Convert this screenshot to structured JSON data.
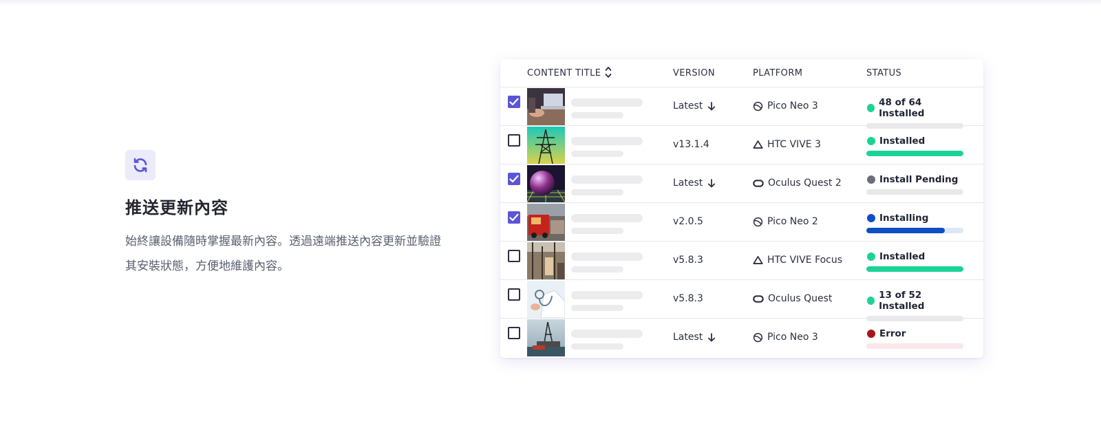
{
  "feature": {
    "title": "推送更新內容",
    "description": "始終讓設備隨時掌握最新內容。透過遠端推送內容更新並驗證其安裝狀態，方便地維護內容。",
    "icon": "refresh-icon",
    "icon_color": "#5b55d6",
    "icon_bg": "#ecebfb"
  },
  "table": {
    "columns": {
      "title": "CONTENT TITLE",
      "version": "VERSION",
      "platform": "PLATFORM",
      "status": "STATUS"
    },
    "rows": [
      {
        "checked": true,
        "thumb": "laptop-desk",
        "version": "Latest",
        "version_arrow": true,
        "platform": "Pico Neo 3",
        "platform_icon": "pico-icon",
        "status": "48 of 64 Installed",
        "status_color": "#1ad396",
        "progress": 0,
        "bar_track": "#e9e9ec",
        "bar_fill": "#1ad396"
      },
      {
        "checked": false,
        "thumb": "power-tower",
        "version": "v13.1.4",
        "version_arrow": false,
        "platform": "HTC VIVE 3",
        "platform_icon": "htc-icon",
        "status": "Installed",
        "status_color": "#1ad396",
        "progress": 1,
        "bar_track": "#e9e9ec",
        "bar_fill": "#1ad396"
      },
      {
        "checked": true,
        "thumb": "sphere-grid",
        "version": "Latest",
        "version_arrow": true,
        "platform": "Oculus Quest 2",
        "platform_icon": "oculus-icon",
        "status": "Install Pending",
        "status_color": "#6b6f7b",
        "progress": 0,
        "bar_track": "#e9e9ec",
        "bar_fill": "#6b6f7b"
      },
      {
        "checked": true,
        "thumb": "fire-truck",
        "version": "v2.0.5",
        "version_arrow": false,
        "platform": "Pico Neo 2",
        "platform_icon": "pico-icon",
        "status": "Installing",
        "status_color": "#0f4fc4",
        "progress": 0.81,
        "bar_track": "#dbe8fb",
        "bar_fill": "#0f4fc4"
      },
      {
        "checked": false,
        "thumb": "factory",
        "version": "v5.8.3",
        "version_arrow": false,
        "platform": "HTC VIVE Focus",
        "platform_icon": "htc-icon",
        "status": "Installed",
        "status_color": "#1ad396",
        "progress": 1,
        "bar_track": "#e9e9ec",
        "bar_fill": "#1ad396"
      },
      {
        "checked": false,
        "thumb": "doctor",
        "version": "v5.8.3",
        "version_arrow": false,
        "platform": "Oculus Quest",
        "platform_icon": "oculus-icon",
        "status": "13 of 52 Installed",
        "status_color": "#1ad396",
        "progress": 0,
        "bar_track": "#e9e9ec",
        "bar_fill": "#1ad396"
      },
      {
        "checked": false,
        "thumb": "oil-rig",
        "version": "Latest",
        "version_arrow": true,
        "platform": "Pico Neo 3",
        "platform_icon": "pico-icon",
        "status": "Error",
        "status_color": "#a8141a",
        "progress": 0,
        "bar_track": "#fbe6ea",
        "bar_fill": "#a8141a"
      }
    ]
  },
  "colors": {
    "accent": "#5b55d6",
    "success": "#1ad396",
    "info": "#0f4fc4",
    "error": "#a8141a",
    "pending": "#6b6f7b"
  }
}
